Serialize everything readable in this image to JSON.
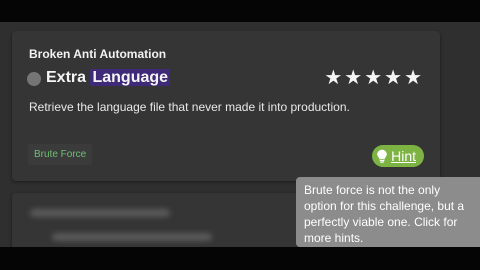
{
  "card": {
    "category_title": "Broken Anti Automation",
    "challenge_name_prefix": "Extra ",
    "challenge_name_highlight": "Language",
    "difficulty_stars": 5,
    "stars": [
      "★",
      "★",
      "★",
      "★",
      "★"
    ],
    "description": "Retrieve the language file that never made it into production.",
    "tag": "Brute Force",
    "hint_label": "Hint"
  },
  "tooltip": {
    "text": "Brute force is not the only\noption for this challenge, but a\nperfectly viable one. Click for\nmore hints."
  },
  "colors": {
    "hint_button": "#7cb342",
    "tag_text": "#6fbf73",
    "highlight": "#3f2a7a",
    "tooltip_bg": "#8c8c8c"
  },
  "icons": {
    "status": "unsolved-dot-icon",
    "difficulty": "star-icon",
    "hint": "lightbulb-icon"
  }
}
